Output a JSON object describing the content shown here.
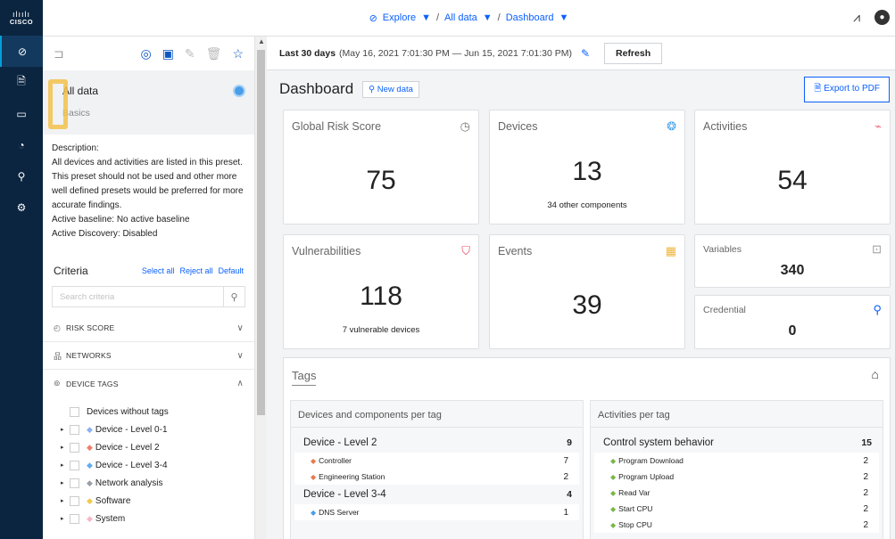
{
  "brand": {
    "logo_bars": "ılıılı",
    "logo_word": "CISCO"
  },
  "nav": {
    "items": [
      {
        "name": "explore-icon",
        "glyph": "◎"
      },
      {
        "name": "reports-icon",
        "glyph": "🗎"
      },
      {
        "name": "calendar-icon",
        "glyph": "▭"
      },
      {
        "name": "radar-icon",
        "glyph": "◔"
      },
      {
        "name": "search-icon",
        "glyph": "⚲"
      },
      {
        "name": "settings-icon",
        "glyph": "⚙"
      }
    ]
  },
  "breadcrumb": {
    "explore": "Explore",
    "all_data": "All data",
    "dashboard": "Dashboard",
    "sep": "/"
  },
  "panel": {
    "preset_name": "All data",
    "preset_sub": "Basics",
    "description": "Description:\nAll devices and activities are listed in this preset. This preset should not be used and other more well defined presets would be preferred for more accurate findings.",
    "baseline": "Active baseline:  No active baseline",
    "discovery": "Active Discovery:  Disabled",
    "criteria_title": "Criteria",
    "select_all": "Select all",
    "reject_all": "Reject all",
    "default": "Default",
    "search_placeholder": "Search criteria",
    "risk_score": "RISK SCORE",
    "networks": "NETWORKS",
    "device_tags": "DEVICE TAGS",
    "no_tags": "Devices without tags",
    "tag_items": [
      {
        "label": "Device - Level 0-1",
        "color": "#8ab0f0"
      },
      {
        "label": "Device - Level 2",
        "color": "#f07d6a"
      },
      {
        "label": "Device - Level 3-4",
        "color": "#60aef0"
      },
      {
        "label": "Network analysis",
        "color": "#9aa0a8"
      },
      {
        "label": "Software",
        "color": "#f2c94c"
      },
      {
        "label": "System",
        "color": "#f6b8c4"
      }
    ]
  },
  "main": {
    "date_label": "Last 30 days",
    "date_range": "(May 16, 2021 7:01:30 PM — Jun 15, 2021 7:01:30 PM)",
    "refresh": "Refresh",
    "title": "Dashboard",
    "new_data": "New data",
    "export": "Export to PDF"
  },
  "cards": {
    "risk": {
      "title": "Global Risk Score",
      "value": "75"
    },
    "devices": {
      "title": "Devices",
      "value": "13",
      "sub": "34 other components"
    },
    "activities": {
      "title": "Activities",
      "value": "54"
    },
    "vulns": {
      "title": "Vulnerabilities",
      "value": "118",
      "sub": "7 vulnerable devices"
    },
    "events": {
      "title": "Events",
      "value": "39"
    },
    "variables": {
      "title": "Variables",
      "value": "340"
    },
    "credential": {
      "title": "Credential",
      "value": "0"
    }
  },
  "tags": {
    "title": "Tags",
    "left": {
      "header": "Devices and components per tag",
      "groups": [
        {
          "label": "Device - Level 2",
          "count": "9",
          "items": [
            {
              "label": "Controller",
              "count": "7"
            },
            {
              "label": "Engineering Station",
              "count": "2"
            }
          ]
        },
        {
          "label": "Device - Level 3-4",
          "count": "4",
          "items": [
            {
              "label": "DNS Server",
              "count": "1"
            }
          ]
        }
      ]
    },
    "right": {
      "header": "Activities per tag",
      "groups": [
        {
          "label": "Control system behavior",
          "count": "15",
          "items": [
            {
              "label": "Program Download",
              "count": "2"
            },
            {
              "label": "Program Upload",
              "count": "2"
            },
            {
              "label": "Read Var",
              "count": "2"
            },
            {
              "label": "Start CPU",
              "count": "2"
            },
            {
              "label": "Stop CPU",
              "count": "2"
            }
          ]
        }
      ]
    }
  },
  "colors": {
    "accent": "#0a60ff",
    "nav_bg": "#0b2540",
    "risk_icon": "#777",
    "devices_icon": "#49a2e8",
    "activities_icon": "#ef6e7a",
    "vulns_icon": "#e84a5f",
    "events_icon": "#f2b63c",
    "tag_orange": "#e8794a",
    "tag_green": "#7ab648",
    "tag_blue": "#4a9ee8"
  }
}
